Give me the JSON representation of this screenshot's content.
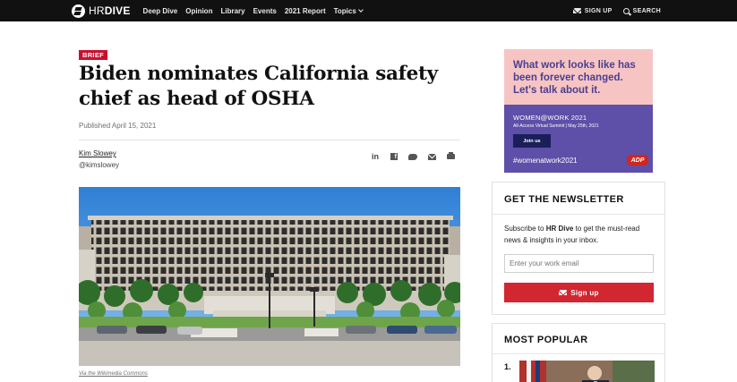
{
  "nav": {
    "logo_hr": "HR",
    "logo_dive": "DIVE",
    "links": [
      "Deep Dive",
      "Opinion",
      "Library",
      "Events",
      "2021 Report",
      "Topics"
    ],
    "signup": "SIGN UP",
    "search": "SEARCH"
  },
  "article": {
    "label": "BRIEF",
    "title": "Biden nominates California safety chief as head of OSHA",
    "published": "Published April 15, 2021",
    "author_name": "Kim Slowey",
    "author_handle": "@kimslowey",
    "caption": "Via the Wikimedia Commons"
  },
  "ad": {
    "headline": "What work looks like has been forever changed. Let's talk about it.",
    "event": "WOMEN@WORK 2021",
    "subline": "All-Access Virtual Summit  |  May 25th, 2021",
    "join": "Join us",
    "hashtag": "#womenatwork2021",
    "brand": "ADP",
    "colors": {
      "top": "#f7c4c4",
      "bottom": "#5e4fa8",
      "text": "#4a3f8f"
    }
  },
  "newsletter": {
    "title": "GET THE NEWSLETTER",
    "desc_pre": "Subscribe to ",
    "desc_brand": "HR Dive",
    "desc_post": " to get the must-read news & insights in your inbox.",
    "placeholder": "Enter your work email",
    "button": "Sign up"
  },
  "popular": {
    "title": "MOST POPULAR",
    "first_num": "1."
  },
  "colors": {
    "accent": "#d22630",
    "nav_bg": "#111111"
  }
}
